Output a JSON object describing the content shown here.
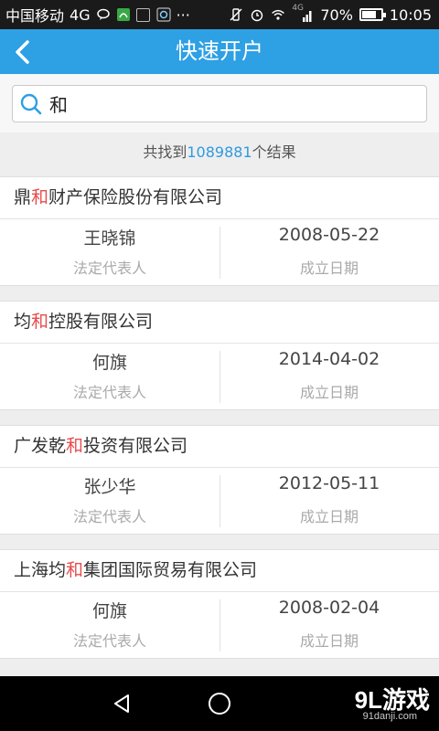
{
  "status_bar": {
    "carrier": "中国移动",
    "network": "4G",
    "overflow": "···",
    "signal_label": "4G",
    "battery_percent": "70%",
    "battery_level": 0.7,
    "time": "10:05"
  },
  "header": {
    "title": "快速开户",
    "back_icon": "back-arrow-icon",
    "color": "#2ea0e4"
  },
  "search": {
    "value": "和",
    "icon": "search-icon"
  },
  "results": {
    "prefix": "共找到",
    "count": "1089881",
    "suffix": "个结果",
    "count_color": "#2e9be0"
  },
  "cards": [
    {
      "name_before": "鼎",
      "name_highlight": "和",
      "name_after": "财产保险股份有限公司",
      "representative": "王晓锦",
      "representative_label": "法定代表人",
      "date": "2008-05-22",
      "date_label": "成立日期"
    },
    {
      "name_before": "均",
      "name_highlight": "和",
      "name_after": "控股有限公司",
      "representative": "何旗",
      "representative_label": "法定代表人",
      "date": "2014-04-02",
      "date_label": "成立日期"
    },
    {
      "name_before": "广发乾",
      "name_highlight": "和",
      "name_after": "投资有限公司",
      "representative": "张少华",
      "representative_label": "法定代表人",
      "date": "2012-05-11",
      "date_label": "成立日期"
    },
    {
      "name_before": "上海均",
      "name_highlight": "和",
      "name_after": "集团国际贸易有限公司",
      "representative": "何旗",
      "representative_label": "法定代表人",
      "date": "2008-02-04",
      "date_label": "成立日期"
    }
  ],
  "highlight_color": "#e84c4c",
  "nav": {
    "back_icon": "nav-back-icon",
    "home_icon": "nav-home-icon"
  },
  "watermark": {
    "brand": "9L游戏",
    "url": "91danji.com"
  }
}
